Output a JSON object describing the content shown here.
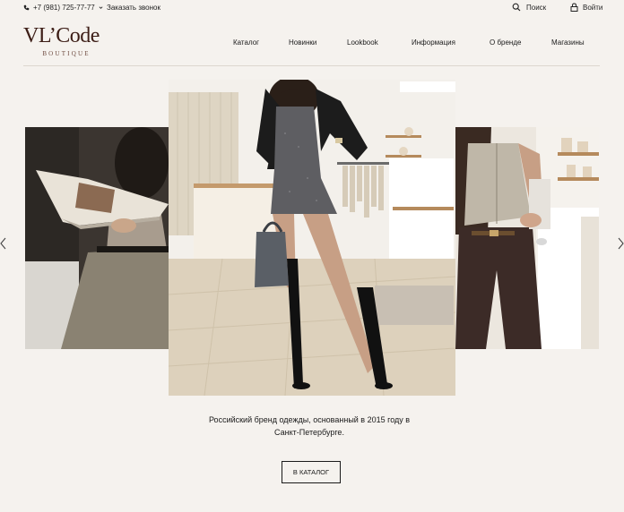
{
  "topbar": {
    "phone": "+7 (981) 725-77-77",
    "callback": "Заказать звонок",
    "search": "Поиск",
    "login": "Войти"
  },
  "logo": {
    "main": "VL’Code",
    "sub": "BOUTIQUE"
  },
  "nav": {
    "items": [
      "Каталог",
      "Новинки",
      "Lookbook",
      "Информация",
      "О бренде",
      "Магазины"
    ]
  },
  "hero": {
    "tagline_line1": "Российский бренд одежды, основанный в 2015 году в",
    "tagline_line2": "Санкт-Петербурге.",
    "button": "В КАТАЛОГ"
  },
  "icons": {
    "phone": "phone-icon",
    "search": "search-icon",
    "login": "lock-icon",
    "prev": "chevron-left-icon",
    "next": "chevron-right-icon"
  }
}
